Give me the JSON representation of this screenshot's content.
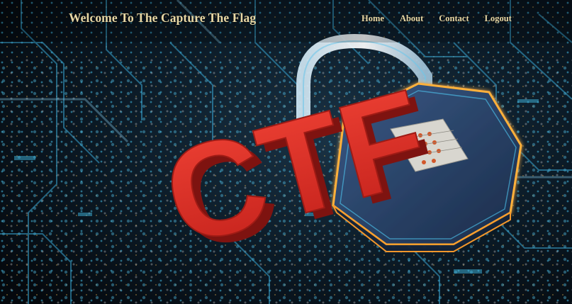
{
  "header": {
    "title": "Welcome To The Capture The Flag",
    "nav": [
      {
        "label": "Home"
      },
      {
        "label": "About"
      },
      {
        "label": "Contact"
      },
      {
        "label": "Logout"
      }
    ]
  },
  "hero": {
    "big_text": "CTF",
    "image_description_icon": "padlock-icon"
  },
  "colors": {
    "nav_text": "#e9d8a5",
    "ctf_red": "#d42a22",
    "lock_glow": "#ffb13a",
    "circuit_cyan": "#3fb6de",
    "background": "#071019"
  }
}
